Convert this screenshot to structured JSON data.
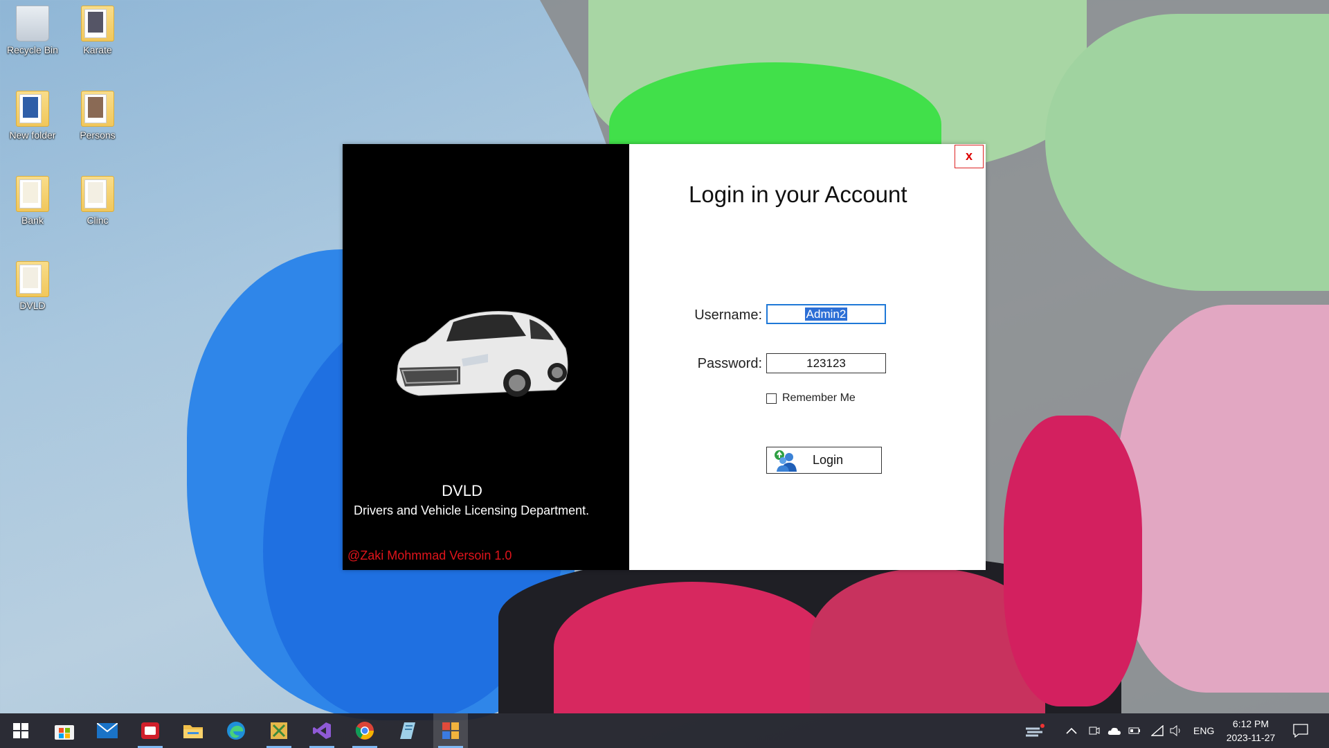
{
  "desktop": {
    "icons": [
      {
        "label": "Recycle Bin"
      },
      {
        "label": "Karate"
      },
      {
        "label": "New folder"
      },
      {
        "label": "Persons"
      },
      {
        "label": "Bank"
      },
      {
        "label": "Clinc"
      },
      {
        "label": "DVLD"
      }
    ]
  },
  "dialog": {
    "close_label": "x",
    "title": "Login in your Account",
    "app_name": "DVLD",
    "app_full_name": "Drivers and Vehicle Licensing Department.",
    "credit": "@Zaki Mohmmad Versoin 1.0",
    "username_label": "Username:",
    "username_value": "Admin2",
    "password_label": "Password:",
    "password_value": "123123",
    "remember_label": "Remember Me",
    "remember_checked": false,
    "login_label": "Login"
  },
  "taskbar": {
    "apps": [
      "start-icon",
      "store-icon",
      "mail-icon",
      "recorder-icon",
      "file-explorer-icon",
      "edge-icon",
      "app-icon",
      "visual-studio-icon",
      "chrome-icon",
      "notes-icon",
      "dvld-app-icon"
    ],
    "language": "ENG",
    "time": "6:12 PM",
    "date": "2023-11-27"
  },
  "colors": {
    "accent": "#2d6fd6",
    "credit_red": "#e0141b",
    "close_red": "#dd0000"
  }
}
